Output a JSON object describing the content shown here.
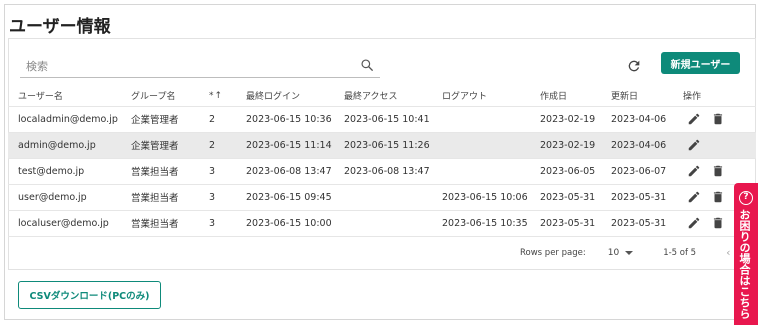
{
  "page": {
    "title": "ユーザー情報"
  },
  "search": {
    "placeholder": "検索",
    "value": ""
  },
  "toolbar": {
    "new_user_label": "新規ユーザー"
  },
  "table": {
    "headers": {
      "username": "ユーザー名",
      "group": "グループ名",
      "level": "*",
      "level_sort": "↑",
      "last_login": "最終ログイン",
      "last_access": "最終アクセス",
      "logout": "ログアウト",
      "created": "作成日",
      "updated": "更新日",
      "ops": "操作"
    },
    "rows": [
      {
        "username": "localadmin@demo.jp",
        "group": "企業管理者",
        "level": "2",
        "last_login": "2023-06-15 10:36",
        "last_access": "2023-06-15 10:41",
        "logout": "",
        "created": "2023-02-19",
        "updated": "2023-04-06",
        "deletable": true,
        "selected": false
      },
      {
        "username": "admin@demo.jp",
        "group": "企業管理者",
        "level": "2",
        "last_login": "2023-06-15 11:14",
        "last_access": "2023-06-15 11:26",
        "logout": "",
        "created": "2023-02-19",
        "updated": "2023-04-06",
        "deletable": false,
        "selected": true
      },
      {
        "username": "test@demo.jp",
        "group": "営業担当者",
        "level": "3",
        "last_login": "2023-06-08 13:47",
        "last_access": "2023-06-08 13:47",
        "logout": "",
        "created": "2023-06-05",
        "updated": "2023-06-07",
        "deletable": true,
        "selected": false
      },
      {
        "username": "user@demo.jp",
        "group": "営業担当者",
        "level": "3",
        "last_login": "2023-06-15 09:45",
        "last_access": "",
        "logout": "2023-06-15 10:06",
        "created": "2023-05-31",
        "updated": "2023-05-31",
        "deletable": true,
        "selected": false
      },
      {
        "username": "localuser@demo.jp",
        "group": "営業担当者",
        "level": "3",
        "last_login": "2023-06-15 10:00",
        "last_access": "",
        "logout": "2023-06-15 10:35",
        "created": "2023-05-31",
        "updated": "2023-05-31",
        "deletable": true,
        "selected": false
      }
    ]
  },
  "pagination": {
    "rows_label": "Rows per page:",
    "rows_value": "10",
    "range": "1-5 of 5"
  },
  "export": {
    "csv_label": "CSVダウンロード(PCのみ)"
  },
  "help": {
    "icon": "?",
    "label": "お困りの場合はこちら"
  },
  "colors": {
    "accent": "#0e8a7a",
    "help": "#e8174e",
    "selected_row": "#eaeaea"
  }
}
